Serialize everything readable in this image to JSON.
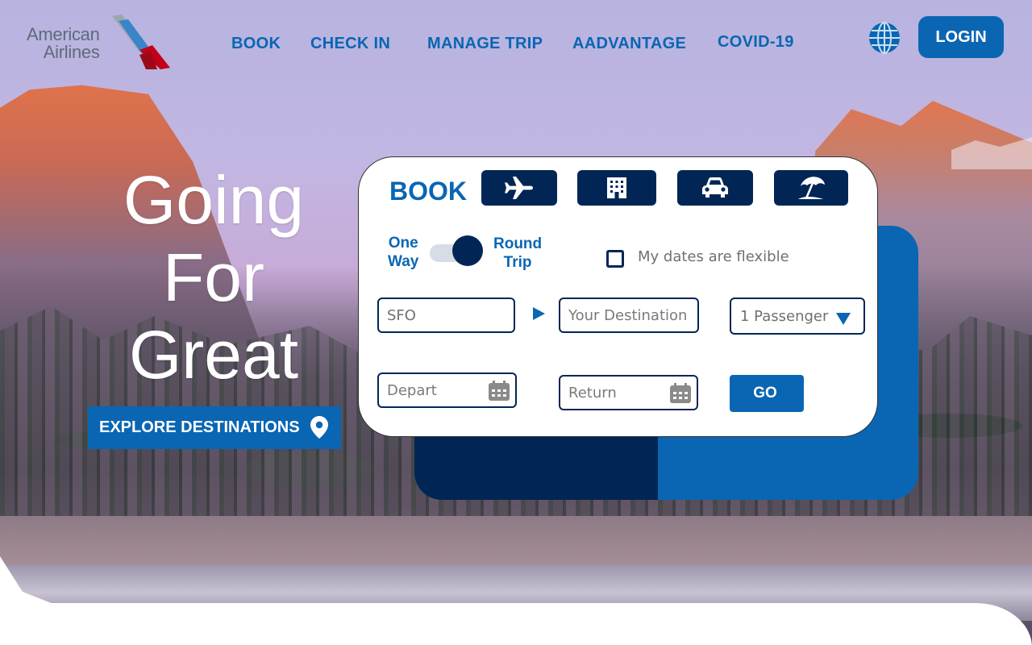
{
  "brand": {
    "line1": "American",
    "line2": "Airlines",
    "colors": {
      "red": "#c30019",
      "blue": "#0a66b3",
      "navy": "#012655",
      "silver": "#9da6ab"
    }
  },
  "nav": [
    {
      "label": "BOOK"
    },
    {
      "label": "CHECK IN"
    },
    {
      "label": "MANAGE TRIP"
    },
    {
      "label": "AADVANTAGE"
    },
    {
      "label": "COVID-19"
    }
  ],
  "header": {
    "globe_icon": "globe-icon",
    "login_label": "LOGIN"
  },
  "hero": {
    "line1": "Going",
    "line2": "For",
    "line3": "Great",
    "explore_label": "EXPLORE DESTINATIONS",
    "explore_icon": "location-pin-icon"
  },
  "booking": {
    "title": "BOOK",
    "tabs": [
      {
        "icon": "airplane-icon"
      },
      {
        "icon": "hotel-icon"
      },
      {
        "icon": "car-icon"
      },
      {
        "icon": "beach-umbrella-icon"
      }
    ],
    "one_way_line1": "One",
    "one_way_line2": "Way",
    "round_trip_line1": "Round",
    "round_trip_line2": "Trip",
    "toggle_state": "round-trip",
    "flexible_label": "My dates are flexible",
    "from_value": "SFO",
    "to_placeholder": "Your Destination",
    "passengers": "1 Passenger",
    "depart_placeholder": "Depart",
    "return_placeholder": "Return",
    "go_label": "GO"
  }
}
